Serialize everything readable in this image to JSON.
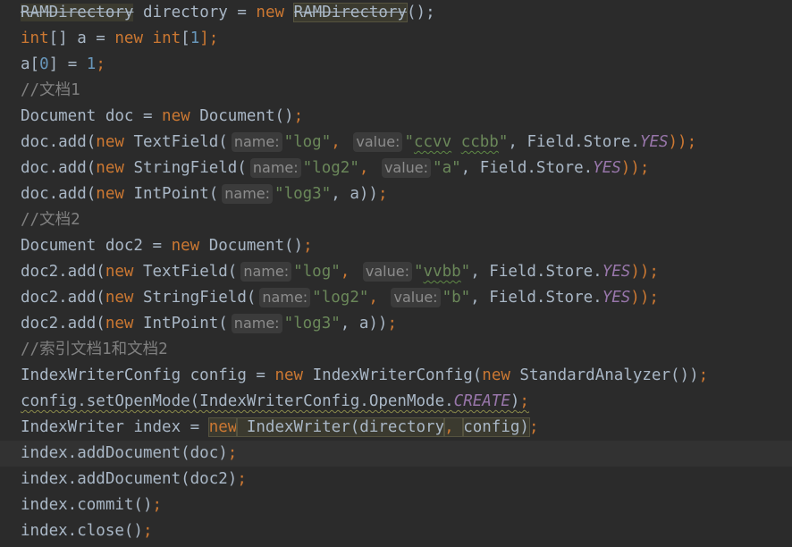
{
  "editor": {
    "lines": {
      "l1": {
        "a": "RAMDirectory",
        "b": " directory = ",
        "c": "new",
        "d": " ",
        "e": "RAMDirectory",
        "f": "();"
      },
      "l2": {
        "a": "int",
        "b": "[] a = ",
        "c": "new",
        "d": " ",
        "e": "int",
        "f": "[",
        "g": "1",
        "h": "];"
      },
      "l3": {
        "a": "a[",
        "b": "0",
        "c": "] = ",
        "d": "1",
        "e": ";"
      },
      "l4": {
        "comment": "//文档1"
      },
      "l5": {
        "a": "Document doc = ",
        "b": "new",
        "c": " Document()",
        "d": ";"
      },
      "l6": {
        "a": "doc.add(",
        "b": "new",
        "c": " TextField(",
        "h1": "name:",
        "s1": "\"log\"",
        "sep": ", ",
        "h2": "value:",
        "s2a": "\"",
        "s2b": "ccvv",
        "s2c": " ",
        "s2d": "ccbb",
        "s2e": "\"",
        "sep2": ", Field.Store.",
        "k": "YES",
        "end": "));"
      },
      "l7": {
        "a": "doc.add(",
        "b": "new",
        "c": " StringField(",
        "h1": "name:",
        "s1": "\"log2\"",
        "sep": ", ",
        "h2": "value:",
        "s2": "\"a\"",
        "sep2": ", Field.Store.",
        "k": "YES",
        "end": "));"
      },
      "l8": {
        "a": "doc.add(",
        "b": "new",
        "c": " IntPoint(",
        "h1": "name:",
        "s1": "\"log3\"",
        "sep": ", a))",
        "end": ";"
      },
      "l9": {
        "comment": "//文档2"
      },
      "l10": {
        "a": "Document doc2 = ",
        "b": "new",
        "c": " Document()",
        "d": ";"
      },
      "l11": {
        "a": "doc2.add(",
        "b": "new",
        "c": " TextField(",
        "h1": "name:",
        "s1": "\"log\"",
        "sep": ", ",
        "h2": "value:",
        "s2a": "\"",
        "s2b": "vvbb",
        "s2c": "\"",
        "sep2": ", Field.Store.",
        "k": "YES",
        "end": "));"
      },
      "l12": {
        "a": "doc2.add(",
        "b": "new",
        "c": " StringField(",
        "h1": "name:",
        "s1": "\"log2\"",
        "sep": ", ",
        "h2": "value:",
        "s2": "\"b\"",
        "sep2": ", Field.Store.",
        "k": "YES",
        "end": "));"
      },
      "l13": {
        "a": "doc2.add(",
        "b": "new",
        "c": " IntPoint(",
        "h1": "name:",
        "s1": "\"log3\"",
        "sep": ", a))",
        "end": ";"
      },
      "l14": {
        "comment": "//索引文档1和文档2"
      },
      "l15": {
        "a": "IndexWriterConfig config = ",
        "b": "new",
        "c": " IndexWriterConfig(",
        "d": "new",
        "e": " StandardAnalyzer())",
        "f": ";"
      },
      "l16": {
        "a": "config.setOpenMode(IndexWriterConfig.OpenMode.",
        "b": "CREATE",
        "c": ")",
        "d": ";"
      },
      "l17": {
        "a": "IndexWriter index = ",
        "b": "new",
        "c": " IndexWriter(directory",
        "d": ", ",
        "e": "config)",
        "f": ";"
      },
      "l18": {
        "a": "index.addDocument(doc)",
        "b": ";"
      },
      "l19": {
        "a": "index.addDocument(doc2)",
        "b": ";"
      },
      "l20": {
        "a": "index.commit()",
        "b": ";"
      },
      "l21": {
        "a": "index.close()",
        "b": ";"
      }
    },
    "colors": {
      "background": "#2b2b2b",
      "keyword": "#cc7832",
      "number": "#6897bb",
      "string": "#6a8759",
      "comment": "#808080",
      "constant": "#9876aa",
      "text": "#a9b7c6"
    }
  }
}
